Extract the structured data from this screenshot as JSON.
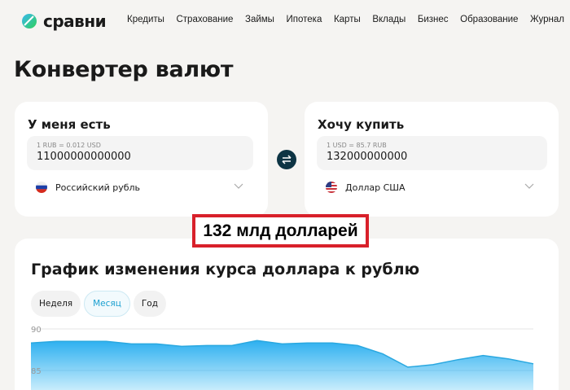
{
  "nav": {
    "logo": "сравни",
    "items": [
      "Кредиты",
      "Страхование",
      "Займы",
      "Ипотека",
      "Карты",
      "Вклады",
      "Бизнес",
      "Образование",
      "Журнал"
    ]
  },
  "page_title": "Конвертер валют",
  "from": {
    "title": "У меня есть",
    "rate": "1 RUB = 0.012 USD",
    "amount": "11000000000000",
    "currency": "Российский рубль"
  },
  "to": {
    "title": "Хочу купить",
    "rate": "1 USD = 85.7 RUB",
    "amount": "132000000000",
    "currency": "Доллар США"
  },
  "callout": "132 млд долларей",
  "chart_section": {
    "title": "График изменения курса доллара к рублю",
    "tabs": [
      "Неделя",
      "Месяц",
      "Год"
    ],
    "active_tab": "Месяц"
  },
  "colors": {
    "accent": "#1a9fd0",
    "line": "#2aa8e0",
    "swap": "#0d3444",
    "callout": "#d8202a"
  },
  "chart_data": {
    "type": "area",
    "title": "График изменения курса доллара к рублю",
    "y_ticks": [
      90,
      85
    ],
    "ylim": [
      80,
      90
    ],
    "grid": true,
    "values": [
      88.3,
      88.5,
      88.5,
      88.5,
      88.2,
      88.2,
      87.9,
      88.0,
      88.0,
      88.6,
      88.2,
      88.3,
      88.3,
      88.0,
      87.0,
      85.4,
      85.7,
      86.3,
      86.8,
      86.4,
      85.8
    ]
  }
}
